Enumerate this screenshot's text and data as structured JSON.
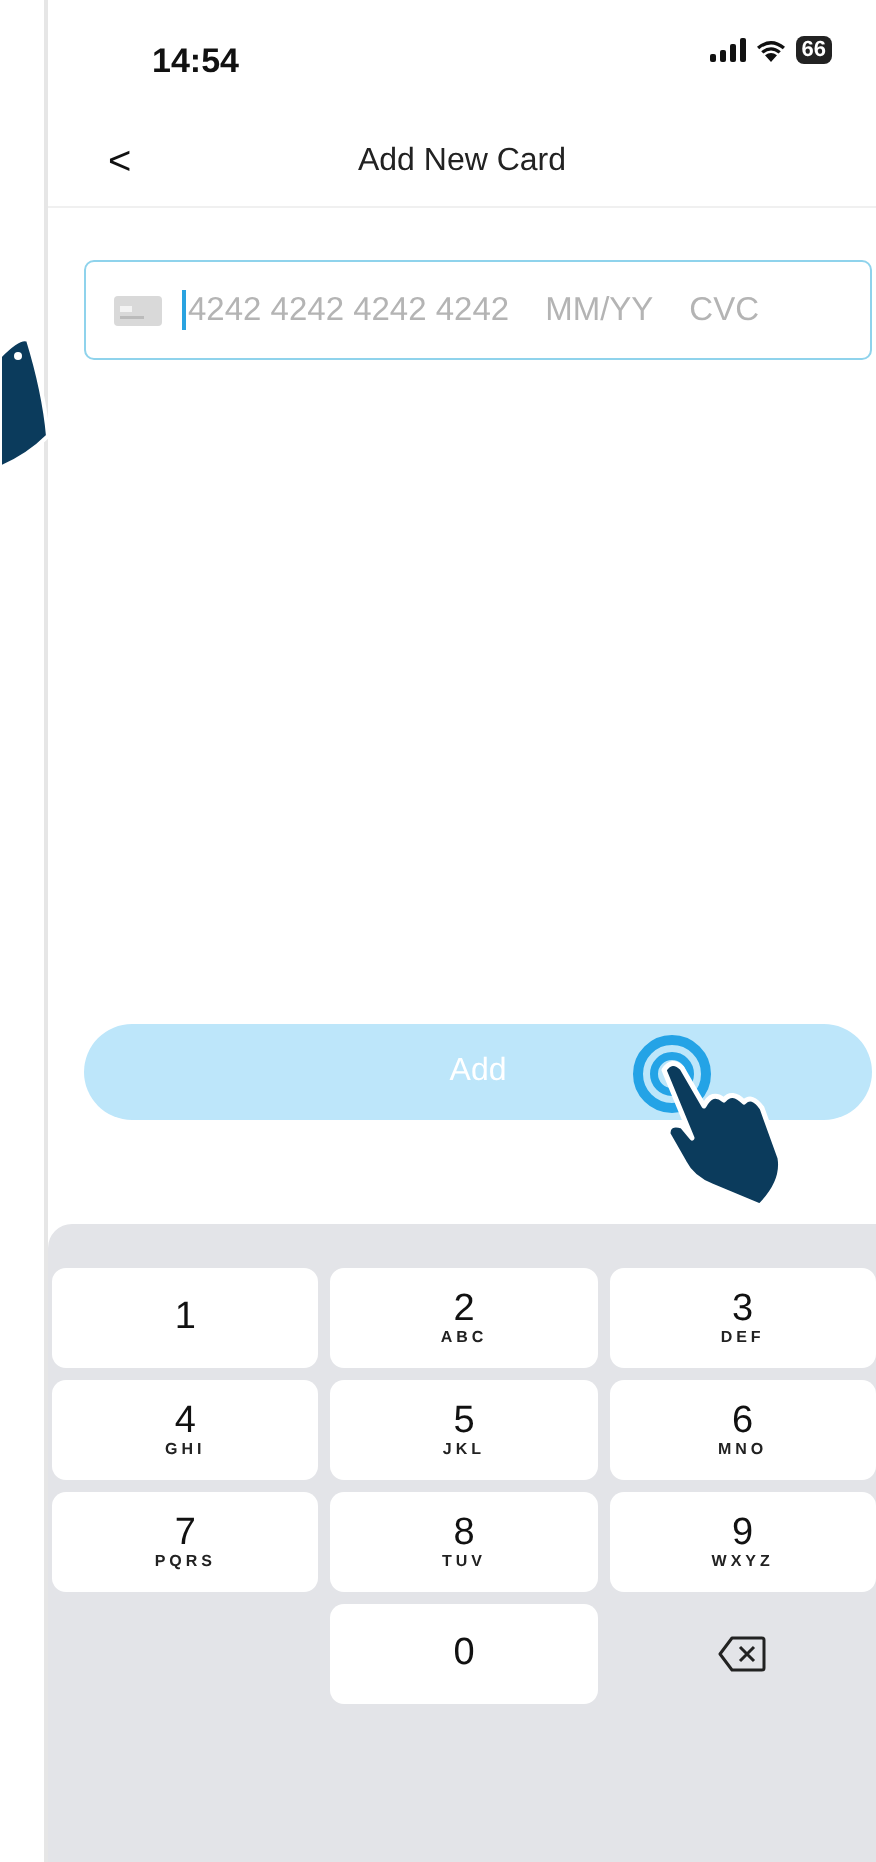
{
  "status_bar": {
    "time": "14:54",
    "battery": "66"
  },
  "nav": {
    "back": "<",
    "title": "Add New Card"
  },
  "card_field": {
    "number_placeholder": "4242 4242 4242 4242",
    "expiry_placeholder": "MM/YY",
    "cvc_placeholder": "CVC",
    "focused": true
  },
  "add_button": {
    "label": "Add",
    "disabled": true
  },
  "keypad": [
    {
      "kind": "digit",
      "digit": "1"
    },
    {
      "kind": "digit",
      "digit": "2",
      "letters": "ABC"
    },
    {
      "kind": "digit",
      "digit": "3",
      "letters": "DEF"
    },
    {
      "kind": "digit",
      "digit": "4",
      "letters": "GHI"
    },
    {
      "kind": "digit",
      "digit": "5",
      "letters": "JKL"
    },
    {
      "kind": "digit",
      "digit": "6",
      "letters": "MNO"
    },
    {
      "kind": "digit",
      "digit": "7",
      "letters": "PQRS"
    },
    {
      "kind": "digit",
      "digit": "8",
      "letters": "TUV"
    },
    {
      "kind": "digit",
      "digit": "9",
      "letters": "WXYZ"
    },
    {
      "kind": "blank"
    },
    {
      "kind": "digit",
      "digit": "0"
    },
    {
      "kind": "delete"
    }
  ]
}
